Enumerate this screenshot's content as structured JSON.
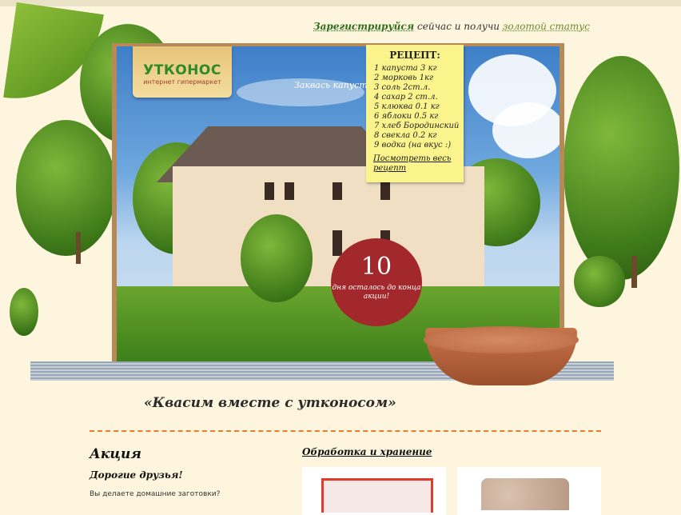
{
  "header": {
    "register_link": "Зарегистрируйся",
    "middle_text": " сейчас и получи ",
    "gold_link": "золотой статус"
  },
  "logo": {
    "brand": "УТКОНОС",
    "subtitle": "интернет гипермаркет"
  },
  "hero": {
    "hint": "Заквась капусту"
  },
  "recipe": {
    "title": "РЕЦЕПТ:",
    "items": [
      "1  капуста    3 кг",
      "2  морковь    1кг",
      "3  соль    2ст.л.",
      "4  сахар    2 ст.л.",
      "5  клюква    0.1 кг",
      "6  яблоки    0.5 кг",
      "7  хлеб Бородинский",
      "8  свекла    0.2 кг",
      "9  водка (на вкус :)"
    ],
    "link": "Посмотреть весь рецепт"
  },
  "counter": {
    "number": "10",
    "text": "дня осталось до конца акции!"
  },
  "tagline": "«Квасим вместе с утконосом»",
  "promo": {
    "title": "Акция",
    "greeting": "Дорогие друзья!",
    "question": "Вы делаете домашние заготовки?"
  },
  "processing": {
    "title": "Обработка и хранение"
  },
  "colors": {
    "counter_bg": "#a3282c",
    "divider": "#f07a2a",
    "recipe_bg": "#fbf48c"
  }
}
